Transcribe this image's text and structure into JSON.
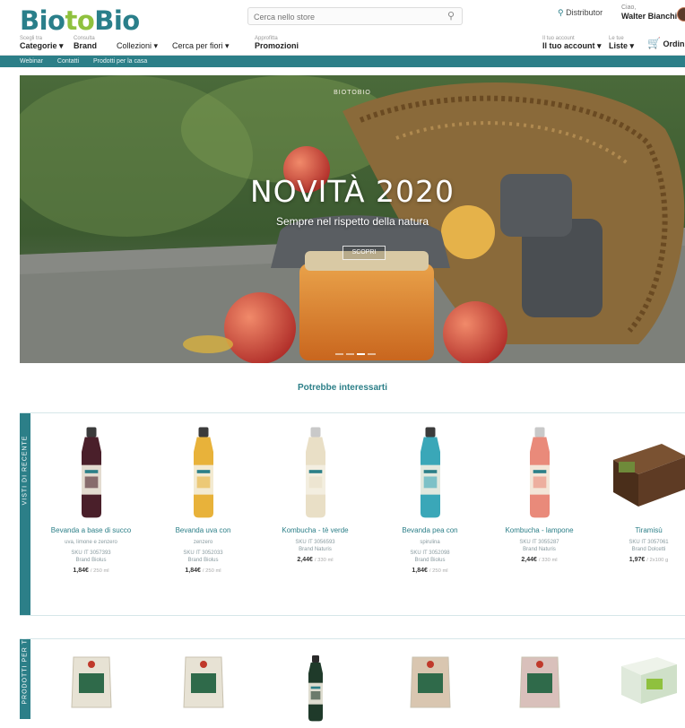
{
  "header": {
    "logo_left": "Bio",
    "logo_mid": "to",
    "logo_right": "Bio",
    "search_placeholder": "Cerca nello store",
    "distributor": "Distributor",
    "account_label": "Ciao,",
    "account_name": "Walter Bianchi",
    "nav": [
      {
        "small": "Scegli tra",
        "label": "Categorie ▾"
      },
      {
        "small": "Consulta",
        "label": "Brand"
      },
      {
        "small": "",
        "label": "Collezioni ▾"
      },
      {
        "small": "",
        "label": "Cerca per fiori ▾"
      },
      {
        "small": "Approfitta",
        "label": "Promozioni"
      }
    ],
    "account_menu": {
      "small": "Il tuo account",
      "label": "Il tuo account ▾"
    },
    "lists": {
      "small": "Le tue",
      "label": "Liste ▾"
    },
    "orders": "Ordini"
  },
  "teal_links": [
    "Webinar",
    "Contatti",
    "Prodotti per la casa"
  ],
  "hero": {
    "kicker": "BIOTOBIO",
    "title": "NOVITÀ 2020",
    "subtitle": "Sempre nel rispetto della natura",
    "button": "SCOPRI"
  },
  "section_title": "Potrebbe interessarti",
  "block1": {
    "label": "VISTI DI RECENTE",
    "products": [
      {
        "name": "Bevanda a base di succo",
        "sub": "uva, limone e zenzero",
        "code": "SKU IT 3057393",
        "brand": "Brand Biolus",
        "price": "1,84€",
        "unit": "/ 250 ml",
        "color": "#4a1f2a",
        "cap": "#3b3b3b"
      },
      {
        "name": "Bevanda uva con",
        "sub": "zenzero",
        "code": "SKU IT 3052033",
        "brand": "Brand Biolus",
        "price": "1,84€",
        "unit": "/ 250 ml",
        "color": "#e8b23a",
        "cap": "#3b3b3b"
      },
      {
        "name": "Kombucha - tè verde",
        "sub": "",
        "code": "SKU IT 3056593",
        "brand": "Brand Naturis",
        "price": "2,44€",
        "unit": "/ 330 ml",
        "color": "#e9dfc6",
        "cap": "#c9c9c9"
      },
      {
        "name": "Bevanda pea con",
        "sub": "spirulina",
        "code": "SKU IT 3052098",
        "brand": "Brand Biolus",
        "price": "1,84€",
        "unit": "/ 250 ml",
        "color": "#3aa7b8",
        "cap": "#3b3b3b"
      },
      {
        "name": "Kombucha - lampone",
        "sub": "",
        "code": "SKU IT 3055287",
        "brand": "Brand Naturis",
        "price": "2,44€",
        "unit": "/ 330 ml",
        "color": "#e98a7a",
        "cap": "#c9c9c9"
      },
      {
        "name": "Tiramisù",
        "sub": "",
        "code": "SKU IT 3057061",
        "brand": "Brand Dolcetti",
        "price": "1,97€",
        "unit": "/ 2x100 g",
        "color": "#5a3a24",
        "cap": "#6f8a3a"
      }
    ]
  },
  "block2": {
    "label": "PRODOTTI PER TE",
    "products": [
      {
        "color": "#e7e2d4"
      },
      {
        "color": "#e7e2d4"
      },
      {
        "color": "#1f3a2a"
      },
      {
        "color": "#d9c6b0"
      },
      {
        "color": "#d9c0bb"
      },
      {
        "color": "#dfeadf"
      }
    ]
  }
}
